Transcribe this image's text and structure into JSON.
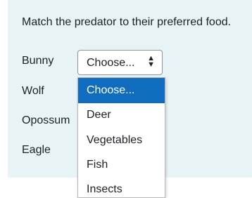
{
  "question": {
    "prompt": "Match the predator to their preferred food."
  },
  "rows": [
    {
      "label": "Bunny"
    },
    {
      "label": "Wolf"
    },
    {
      "label": "Opossum"
    },
    {
      "label": "Eagle"
    }
  ],
  "select": {
    "value": "Choose...",
    "arrow_icon": "sort-arrows-icon"
  },
  "dropdown": {
    "options": [
      "Choose...",
      "Deer",
      "Vegetables",
      "Fish",
      "Insects"
    ],
    "highlighted": "Choose..."
  },
  "colors": {
    "panel_background": "#e7f3f5",
    "highlight": "#0f6cbf"
  }
}
